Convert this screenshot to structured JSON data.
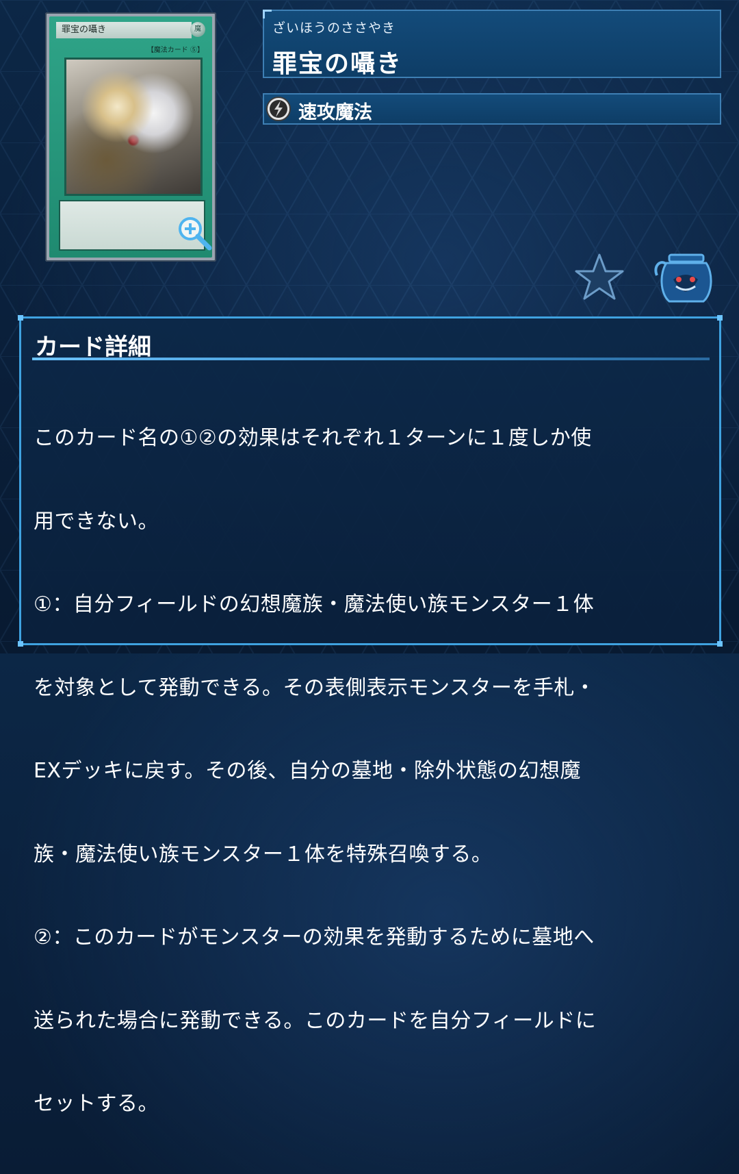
{
  "card": {
    "art_name": "罪宝の囁き",
    "type_tag": "【魔法カード ⑤】",
    "attribute_label": "魔"
  },
  "name": {
    "ruby": "ざいほうのささやき",
    "title": "罪宝の囁き"
  },
  "card_type": {
    "icon": "quick-play-spell-icon",
    "label": "速攻魔法"
  },
  "icons": {
    "favorite": "star-icon",
    "collection": "pot-icon",
    "zoom": "zoom-in-icon"
  },
  "details": {
    "heading": "カード詳細",
    "lines": [
      "このカード名の①②の効果はそれぞれ１ターンに１度しか使",
      "用できない。",
      "①：自分フィールドの幻想魔族・魔法使い族モンスター１体",
      "を対象として発動できる。その表側表示モンスターを手札・",
      "EXデッキに戻す。その後、自分の墓地・除外状態の幻想魔",
      "族・魔法使い族モンスター１体を特殊召喚する。",
      "②：このカードがモンスターの効果を発動するために墓地へ",
      "送られた場合に発動できる。このカードを自分フィールドに",
      "セットする。"
    ]
  },
  "colors": {
    "background": "#0b2240",
    "panel": "#134b7a",
    "accent": "#3fa2e0",
    "spell_card": "#1f8a70"
  }
}
